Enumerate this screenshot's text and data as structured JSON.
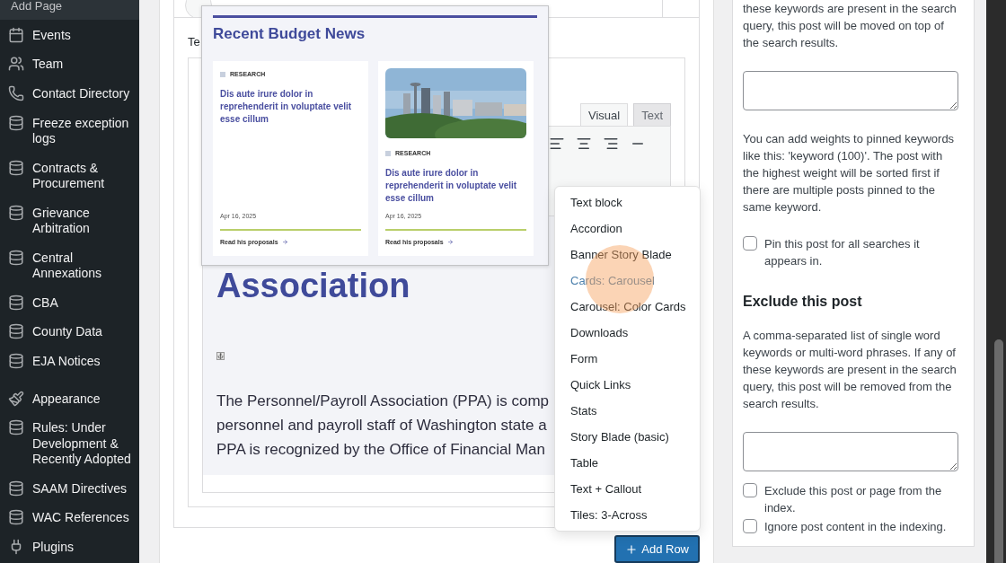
{
  "sidebar": {
    "top_item": "Add Page",
    "groups": [
      [
        {
          "label": "Events"
        },
        {
          "label": "Team"
        },
        {
          "label": "Contact Directory"
        },
        {
          "label": "Freeze exception logs"
        },
        {
          "label": "Contracts & Procurement"
        },
        {
          "label": "Grievance Arbitration"
        },
        {
          "label": "Central Annexations"
        },
        {
          "label": "CBA"
        },
        {
          "label": "County Data"
        },
        {
          "label": "EJA Notices"
        }
      ],
      [
        {
          "label": "Appearance"
        },
        {
          "label": "Rules: Under Development & Recently Adopted"
        },
        {
          "label": "SAAM Directives"
        },
        {
          "label": "WAC References"
        },
        {
          "label": "Plugins"
        }
      ]
    ]
  },
  "editor": {
    "field_label": "Te",
    "tabs": [
      {
        "label": "Visual",
        "selected": true
      },
      {
        "label": "Text",
        "selected": false
      }
    ],
    "content": {
      "heading": "Association",
      "paragraph_lines": [
        "The Personnel/Payroll Association (PPA) is comp",
        "personnel and payroll staff of Washington state a",
        "PPA is recognized by the Office of Financial Man"
      ]
    }
  },
  "preview": {
    "title": "Recent Budget News",
    "cards": [
      {
        "image": false,
        "tag": "RESEARCH",
        "title": "Dis aute irure dolor in reprehenderit in voluptate velit esse cillum",
        "date": "Apr 16, 2025",
        "link": "Read his proposals"
      },
      {
        "image": true,
        "tag": "RESEARCH",
        "title": "Dis aute irure dolor in reprehenderit in voluptate velit esse cillum",
        "date": "Apr 16, 2025",
        "link": "Read his proposals"
      }
    ]
  },
  "menu": {
    "items": [
      {
        "label": "Text block",
        "selected": false
      },
      {
        "label": "Accordion",
        "selected": false
      },
      {
        "label": "Banner Story Blade",
        "selected": false
      },
      {
        "label": "Cards: Carousel",
        "selected": true
      },
      {
        "label": "Carousel: Color Cards",
        "selected": false
      },
      {
        "label": "Downloads",
        "selected": false
      },
      {
        "label": "Form",
        "selected": false
      },
      {
        "label": "Quick Links",
        "selected": false
      },
      {
        "label": "Stats",
        "selected": false
      },
      {
        "label": "Story Blade (basic)",
        "selected": false
      },
      {
        "label": "Table",
        "selected": false
      },
      {
        "label": "Text + Callout",
        "selected": false
      },
      {
        "label": "Tiles: 3-Across",
        "selected": false
      }
    ]
  },
  "add_row_button": "Add Row",
  "search_panel": {
    "pin_text": "these keywords are present in the search query, this post will be moved on top of the search results.",
    "weights_text": "You can add weights to pinned keywords like this: 'keyword (100)'. The post with the highest weight will be sorted first if there are multiple posts pinned to the same keyword.",
    "pin_all": {
      "label": "Pin this post for all searches it appears in.",
      "checked": false
    },
    "exclude_heading": "Exclude this post",
    "exclude_text": "A comma-separated list of single word keywords or multi-word phrases. If any of these keywords are present in the search query, this post will be removed from the search results.",
    "checkboxes": [
      {
        "label": "Exclude this post or page from the index.",
        "checked": false
      },
      {
        "label": "Ignore post content in the indexing.",
        "checked": false
      }
    ]
  }
}
